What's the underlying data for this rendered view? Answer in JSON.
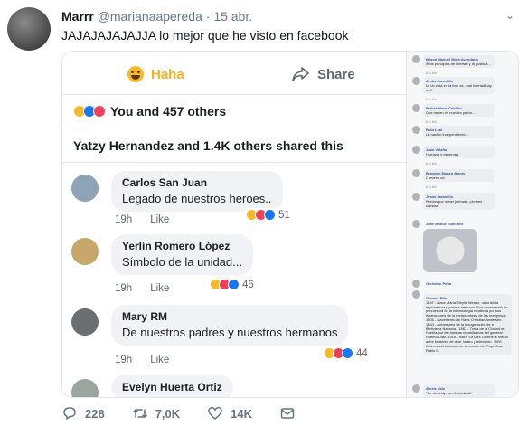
{
  "tweet": {
    "display_name": "Marrr",
    "handle": "@marianaapereda",
    "separator": "·",
    "date": "15 abr.",
    "text": "JAJAJAJAJAJJA lo mejor que he visto en facebook"
  },
  "fb": {
    "reaction_label": "Haha",
    "share_label": "Share",
    "reactions_summary": "You and 457 others",
    "shared_summary": "Yatzy Hernandez and 1.4K others shared this",
    "comments": [
      {
        "name": "Carlos San Juan",
        "text": "Legado de nuestros heroes..",
        "time": "19h",
        "like": "Like",
        "count": "51"
      },
      {
        "name": "Yerlín Romero López",
        "text": "Símbolo de la unidad...",
        "time": "19h",
        "like": "Like",
        "count": "46"
      },
      {
        "name": "Mary RM",
        "text": "De nuestros padres y nuestros hermanos",
        "time": "19h",
        "like": "Like",
        "count": "44"
      },
      {
        "name": "Evelyn Huerta Ortiz",
        "text": "",
        "time": "",
        "like": "",
        "count": ""
      }
    ],
    "side_comments": [
      {
        "name": "Edson Manuel Mora Avendaño",
        "text": "A los principios de libertad y de justicia...",
        "meta": "1h  Like"
      },
      {
        "name": "Jesús Jaramillo",
        "text": "Mi tío está en la foto xd, cual libertad hay ahí?",
        "meta": "1h  Like"
      },
      {
        "name": "Esther María Castillo",
        "text": "Que hacen de nuestra patria...",
        "meta": "1h  Like"
      },
      {
        "name": "Rubí Leal",
        "text": "La nación independiente...",
        "meta": "1h  Like"
      },
      {
        "name": "Juan Valaño",
        "text": "Humana y generosa",
        "meta": "1h  Like"
      },
      {
        "name": "Brandon Moseo Alanís",
        "text": "C mamo xd",
        "meta": "1h  Like"
      },
      {
        "name": "Jesús Jaramillo",
        "text": "Perdón por meter jimbado, pinches razistas",
        "meta": "1h  Like"
      },
      {
        "name": "José Manuel Sánchez",
        "text": "",
        "meta": ""
      },
      {
        "name": "Christián Peña",
        "text": "",
        "meta": "1h  Like"
      },
      {
        "name": "Gimena Pita",
        "text": "",
        "meta": ""
      },
      {
        "name": "Alexis Valo",
        "text": "\"Ce desmaye un desmuindo\"",
        "meta": "1h  Like"
      }
    ],
    "side_long_text": "1647 - Nace María Sibylla Merian, naturalista exploradora y pintora alemana. Fue considerada la precursora de la entomología moderna por sus ilustraciones de la metamorfosis de las mariposas. 1805 - Nacimiento de Hans Christian Andersen. 1844 - Aniversario de la inauguración de la Biblioteca Nacional. 1867 - Toma de la Ciudad de Puebla por las fuerzas republicanas del general Porfirio Díaz. 1916 - Nace Sir Alec Guinness fue un actor británico de cine, teatro y televisión. 2005 - Aniversario luctuoso de la muerte del Papa Juan Pablo II."
  },
  "actions": {
    "replies": "228",
    "retweets": "7,0K",
    "likes": "14K"
  },
  "colors": {
    "haha": "#f7b125",
    "like": "#1877f2",
    "love": "#f33e58",
    "twitter_gray": "#657786"
  }
}
